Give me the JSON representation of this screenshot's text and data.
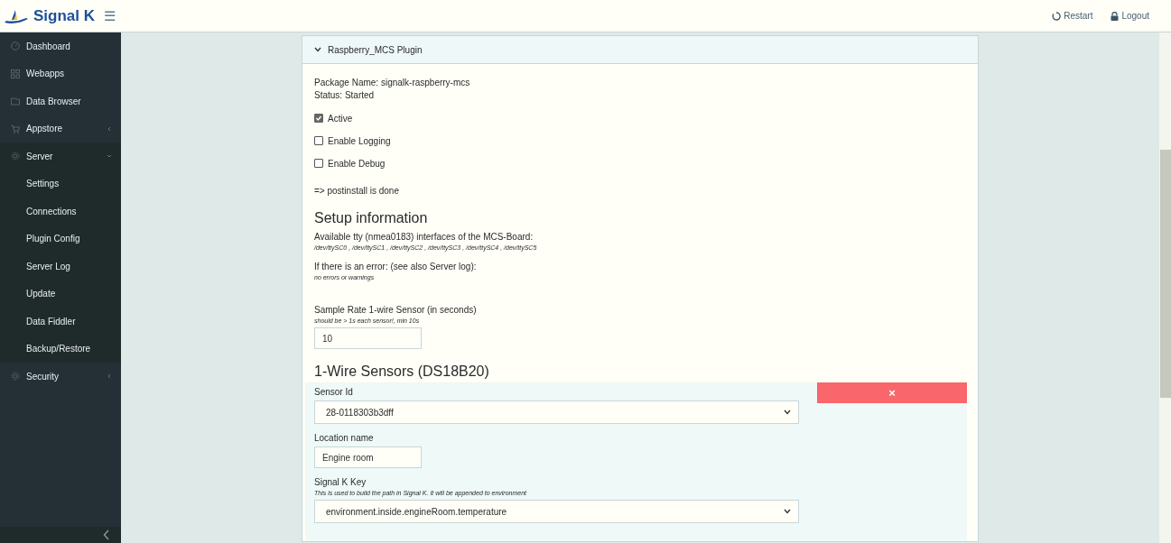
{
  "header": {
    "brand": "Signal K",
    "menu_icon": "☰",
    "actions": [
      {
        "label": "Restart"
      },
      {
        "label": "Logout"
      }
    ]
  },
  "sidebar": {
    "items": [
      {
        "label": "Dashboard"
      },
      {
        "label": "Webapps"
      },
      {
        "label": "Data Browser"
      },
      {
        "label": "Appstore",
        "expanded": false
      },
      {
        "label": "Server",
        "expanded": true,
        "children": [
          {
            "label": "Settings"
          },
          {
            "label": "Connections"
          },
          {
            "label": "Plugin Config"
          },
          {
            "label": "Server Log"
          },
          {
            "label": "Update"
          },
          {
            "label": "Data Fiddler"
          },
          {
            "label": "Backup/Restore"
          }
        ]
      },
      {
        "label": "Security",
        "expanded": false
      }
    ]
  },
  "plugin": {
    "title": "Raspberry_MCS Plugin",
    "expanded": true,
    "package_name": "Package Name: signalk-raspberry-mcs",
    "status": "Status: Started",
    "options": [
      {
        "label": "Active",
        "checked": true
      },
      {
        "label": "Enable Logging",
        "checked": false
      },
      {
        "label": "Enable Debug",
        "checked": false
      }
    ],
    "postinstall": "=> postinstall is done",
    "setup_heading": "Setup information",
    "tty_label": "Available tty (nmea0183) interfaces of the MCS-Board:",
    "tty_list": "/dev/ttySC0 , /dev/ttySC1 , /dev/ttySC2 , /dev/ttySC3 , /dev/ttySC4 , /dev/ttySC5",
    "error_label": "If there is an error: (see also Server log):",
    "error_text": "no errors or warnings",
    "sample_rate": {
      "label": "Sample Rate 1-wire Sensor (in seconds)",
      "hint": "should be > 1s each sensor!, min 10s",
      "value": "10"
    },
    "sensors_heading": "1-Wire Sensors (DS18B20)",
    "sensors": [
      {
        "remove": "×",
        "sensor_id": {
          "label": "Sensor Id",
          "value": "28-0118303b3dff"
        },
        "location": {
          "label": "Location name",
          "value": "Engine room"
        },
        "key": {
          "label": "Signal K Key",
          "hint": "This is used to build the path in Signal K. It will be appended to environment",
          "value": "environment.inside.engineRoom.temperature"
        }
      }
    ]
  }
}
